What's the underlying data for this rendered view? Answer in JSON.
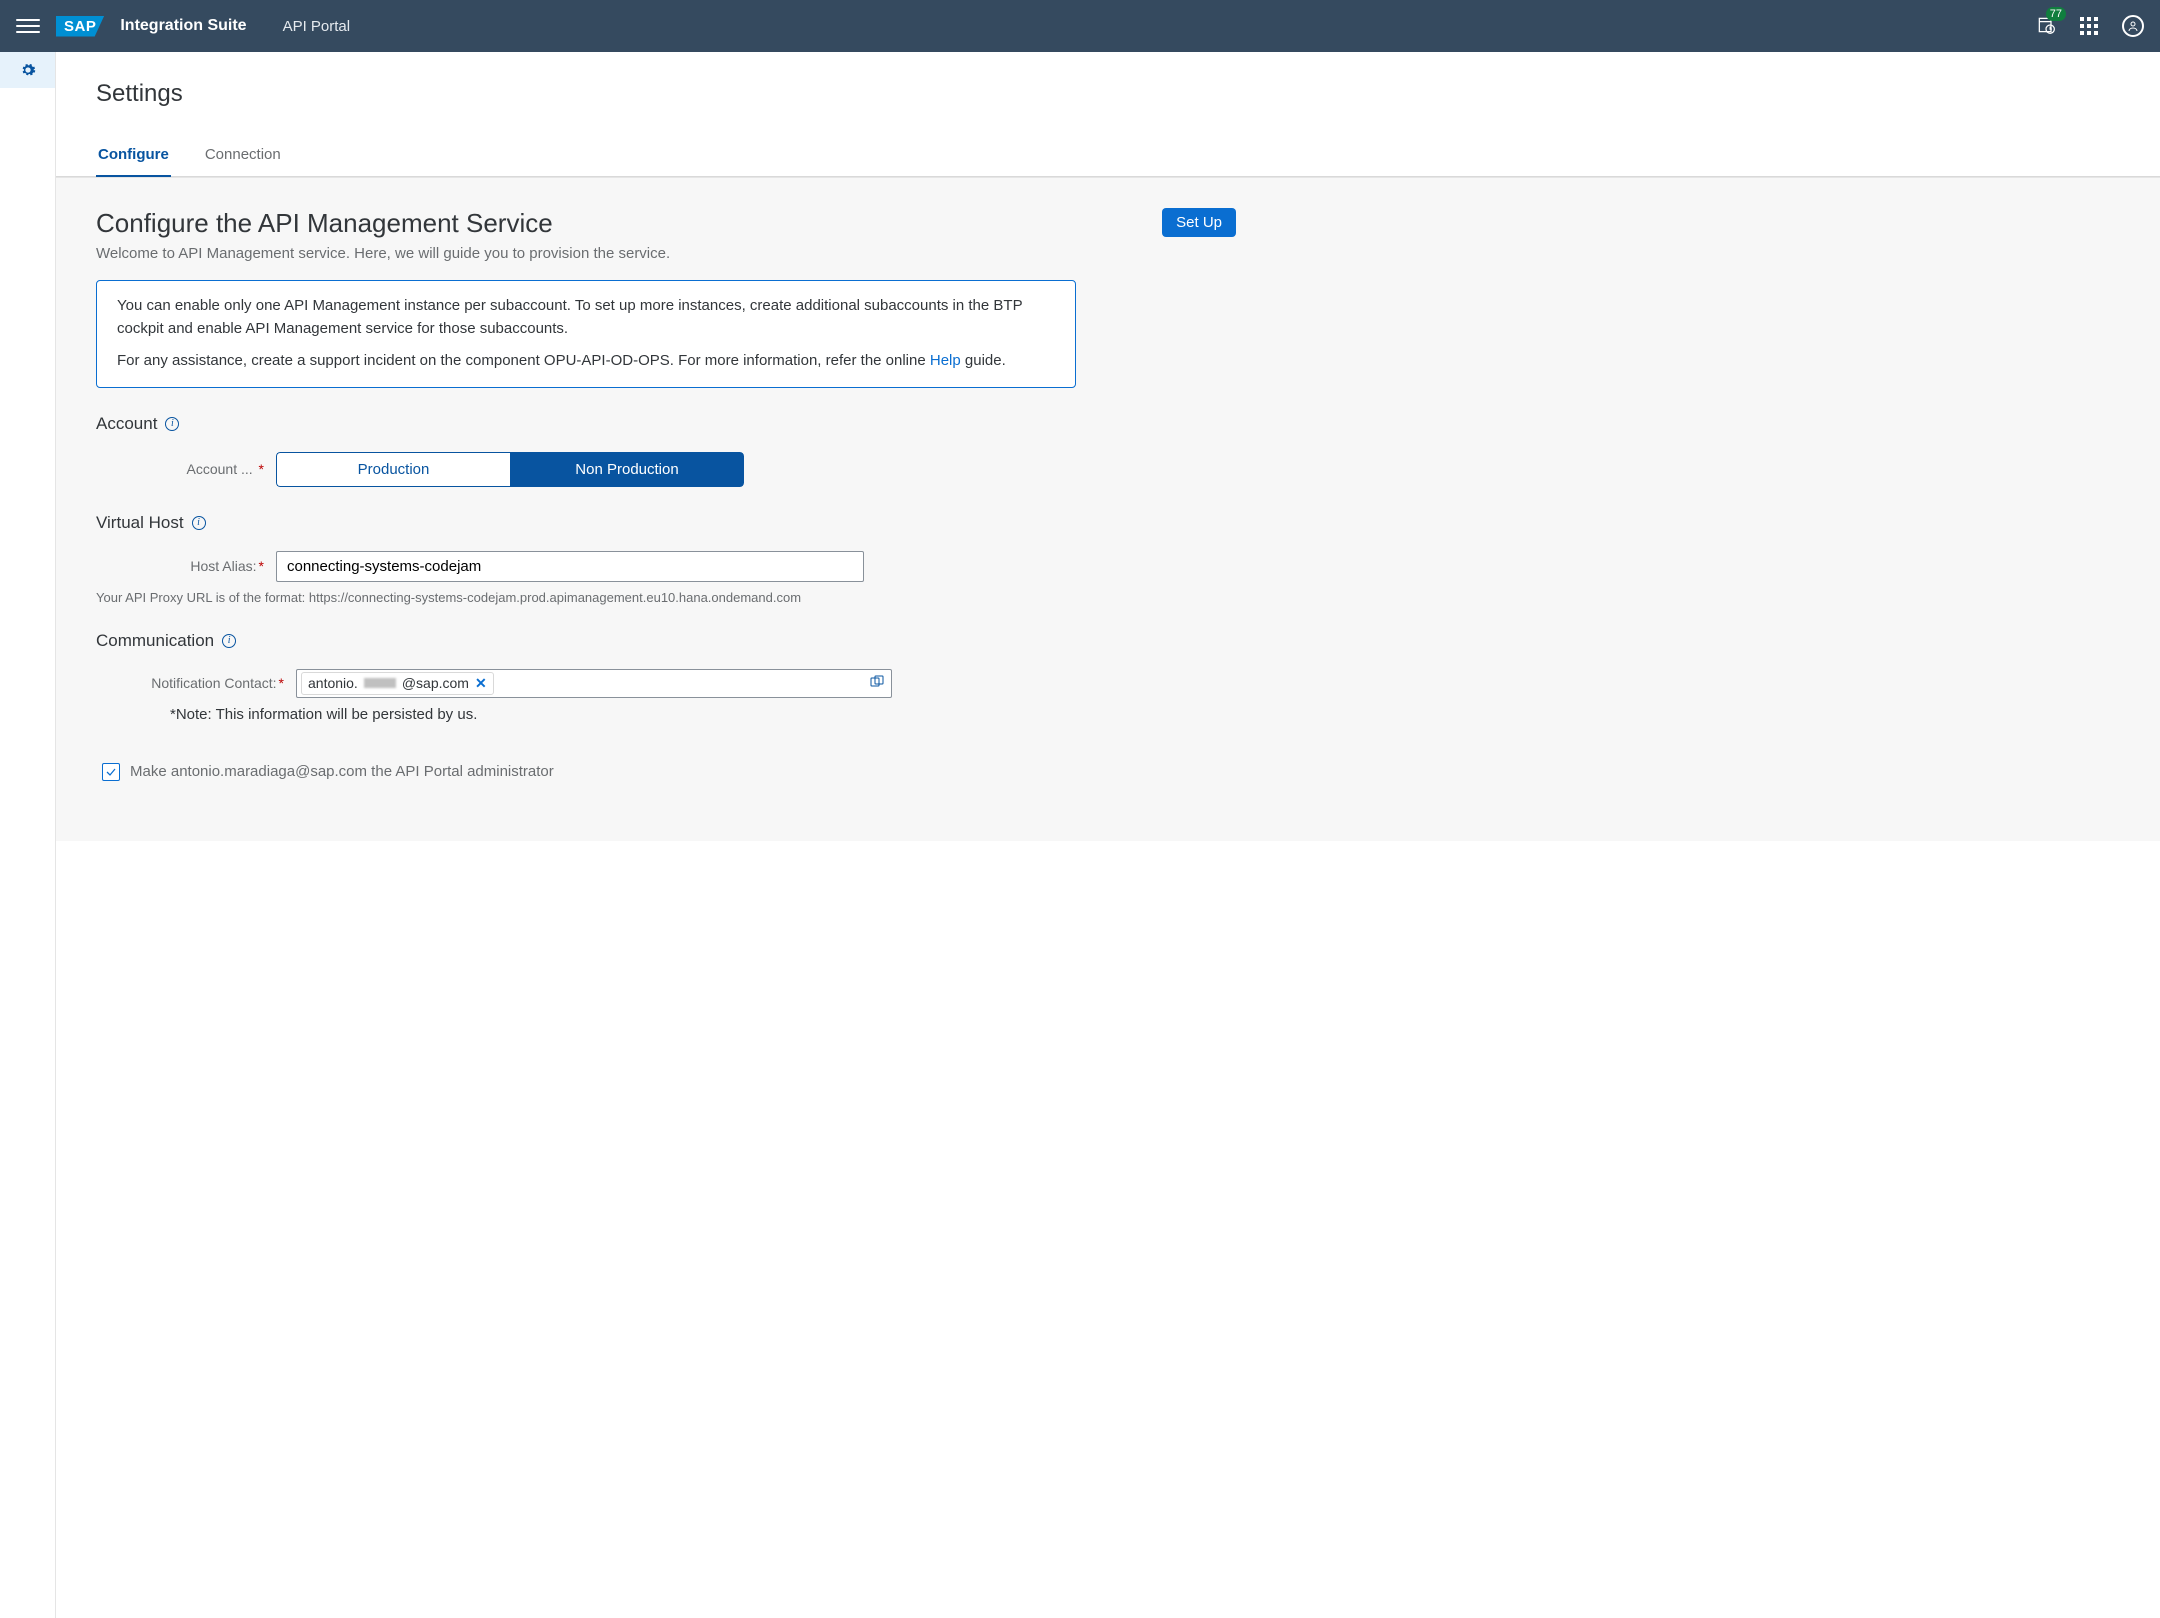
{
  "shell": {
    "logo_text": "SAP",
    "suite_title": "Integration Suite",
    "portal_title": "API Portal",
    "notification_count": "77"
  },
  "page": {
    "title": "Settings",
    "tabs": [
      {
        "label": "Configure",
        "active": true
      },
      {
        "label": "Connection",
        "active": false
      }
    ]
  },
  "panel": {
    "title": "Configure the API Management Service",
    "subtitle": "Welcome to API Management service. Here, we will guide you to provision the service.",
    "setup_button": "Set Up",
    "info1": "You can enable only one API Management instance per subaccount. To set up more instances, create additional subaccounts in the BTP cockpit and enable API Management service for those subaccounts.",
    "info2_pre": "For any assistance, create a support incident on the component OPU-API-OD-OPS. For more information, refer the online ",
    "info2_link": "Help",
    "info2_post": " guide."
  },
  "account": {
    "section_title": "Account",
    "label": "Account ...",
    "options": {
      "production": "Production",
      "non_production": "Non Production"
    }
  },
  "vhost": {
    "section_title": "Virtual Host",
    "label": "Host Alias:",
    "value": "connecting-systems-codejam",
    "hint": "Your API Proxy URL is of the format: https://connecting-systems-codejam.prod.apimanagement.eu10.hana.ondemand.com"
  },
  "comm": {
    "section_title": "Communication",
    "label": "Notification Contact:",
    "token_prefix": "antonio.",
    "token_suffix": "@sap.com",
    "note": "*Note: This information will be persisted by us.",
    "admin_checkbox_label": "Make antonio.maradiaga@sap.com the API Portal administrator"
  }
}
